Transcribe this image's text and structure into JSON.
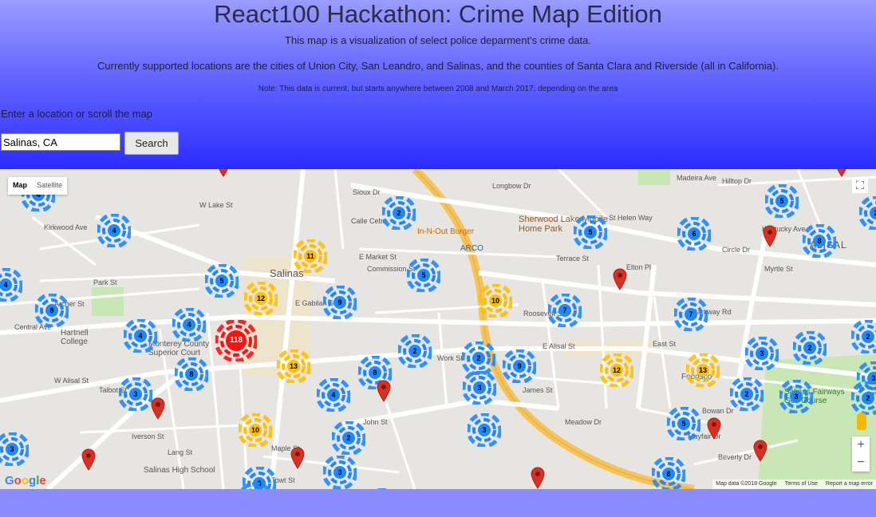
{
  "header": {
    "title": "React100 Hackathon: Crime Map Edition",
    "subtitle": "This map is a visualization of select police deparment's crime data.",
    "locations": "Currently supported locations are the cities of Union City, San Leandro, and Salinas, and the counties of Santa Clara and Riverside (all in California).",
    "note": "Note: This data is current, but starts anywhere between 2008 and March 2017, depending on the area",
    "prompt": "Enter a location or scroll the map"
  },
  "search": {
    "value": "Salinas, CA",
    "button_label": "Search"
  },
  "map": {
    "type_map": "Map",
    "type_satellite": "Satellite",
    "fullscreen_icon": "fullscreen-icon",
    "zoom_in": "+",
    "zoom_out": "−",
    "logo": "Google",
    "attribution": "Map data ©2018 Google",
    "terms": "Terms of Use",
    "report": "Report a map error",
    "colors": {
      "blue": "#1e88ff",
      "yellow": "#ffbf00",
      "red": "#ff1010",
      "pin": "#d93025"
    },
    "place_labels": [
      "Hartnell College",
      "Monterey County Superior Court",
      "Sherwood Lake Mobile Home Park",
      "In-N-Out Burger",
      "ARCO",
      "Foodsco",
      "Salinas Fairways Golf Course",
      "Salinas High School",
      "ALISAL",
      "Salinas"
    ],
    "street_labels": [
      "W Lake St",
      "Sioux Dr",
      "Calle Cebu",
      "E Market St",
      "Commission St",
      "Central Ave",
      "W Alisal St",
      "E Alisal St",
      "John St",
      "Roosevelt St",
      "Terrace St",
      "Parkway Rd",
      "E Gabilan St",
      "Kirkwood Ave",
      "Archer St",
      "Park St",
      "Talbot St",
      "Iverson St",
      "Lang St",
      "Maple St",
      "Towt St",
      "Work St",
      "James St",
      "East St",
      "Elton Pl",
      "Circle Dr",
      "Beverly Dr",
      "Mayfair Dr",
      "Bowan Dr",
      "Meadow Dr",
      "St Helen Way",
      "Madeira Ave",
      "Longbow Dr",
      "Hilltop Dr",
      "Kentucky Ave",
      "Myrtle St"
    ],
    "clusters": [
      {
        "count": "4",
        "color": "blue"
      },
      {
        "count": "2",
        "color": "blue"
      },
      {
        "count": "2",
        "color": "blue"
      },
      {
        "count": "5",
        "color": "blue"
      },
      {
        "count": "6",
        "color": "blue"
      },
      {
        "count": "8",
        "color": "blue"
      },
      {
        "count": "5",
        "color": "blue"
      },
      {
        "count": "4",
        "color": "blue"
      },
      {
        "count": "11",
        "color": "yellow"
      },
      {
        "count": "5",
        "color": "blue"
      },
      {
        "count": "12",
        "color": "yellow"
      },
      {
        "count": "5",
        "color": "blue"
      },
      {
        "count": "10",
        "color": "yellow"
      },
      {
        "count": "8",
        "color": "blue"
      },
      {
        "count": "9",
        "color": "blue"
      },
      {
        "count": "4",
        "color": "blue"
      },
      {
        "count": "7",
        "color": "blue"
      },
      {
        "count": "7",
        "color": "blue"
      },
      {
        "count": "4",
        "color": "blue"
      },
      {
        "count": "118",
        "color": "red"
      },
      {
        "count": "4",
        "color": "blue"
      },
      {
        "count": "2",
        "color": "blue"
      },
      {
        "count": "3",
        "color": "blue"
      },
      {
        "count": "2",
        "color": "blue"
      },
      {
        "count": "13",
        "color": "yellow"
      },
      {
        "count": "9",
        "color": "blue"
      },
      {
        "count": "12",
        "color": "yellow"
      },
      {
        "count": "13",
        "color": "yellow"
      },
      {
        "count": "2",
        "color": "blue"
      },
      {
        "count": "8",
        "color": "blue"
      },
      {
        "count": "8",
        "color": "blue"
      },
      {
        "count": "3",
        "color": "blue"
      },
      {
        "count": "4",
        "color": "blue"
      },
      {
        "count": "2",
        "color": "blue"
      },
      {
        "count": "3",
        "color": "blue"
      },
      {
        "count": "3",
        "color": "blue"
      },
      {
        "count": "10",
        "color": "yellow"
      },
      {
        "count": "3",
        "color": "blue"
      },
      {
        "count": "2",
        "color": "blue"
      },
      {
        "count": "5",
        "color": "blue"
      },
      {
        "count": "3",
        "color": "blue"
      },
      {
        "count": "3",
        "color": "blue"
      },
      {
        "count": "8",
        "color": "blue"
      },
      {
        "count": "3",
        "color": "blue"
      },
      {
        "count": "4",
        "color": "blue"
      },
      {
        "count": "2",
        "color": "blue"
      },
      {
        "count": "2",
        "color": "blue"
      },
      {
        "count": "2",
        "color": "blue"
      },
      {
        "count": "2",
        "color": "blue"
      },
      {
        "count": "3",
        "color": "blue"
      }
    ]
  }
}
